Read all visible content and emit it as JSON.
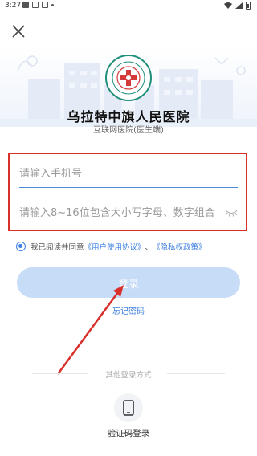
{
  "status_bar": {
    "time": "3:27"
  },
  "header": {
    "close_icon": "close-icon"
  },
  "brand": {
    "title": "乌拉特中旗人民医院",
    "subtitle": "互联网医院(医生端)",
    "logo_icon": "hospital-logo-icon"
  },
  "form": {
    "phone_placeholder": "请输入手机号",
    "phone_value": "",
    "password_placeholder": "请输入8~16位包含大小写字母、数字组合",
    "password_value": "",
    "eye_icon": "eye-closed-icon"
  },
  "agreement": {
    "checked": true,
    "prefix": "我已阅读并同意",
    "user_agreement": "《用户使用协议》",
    "separator": "、",
    "privacy_policy": "《隐私权政策》"
  },
  "login": {
    "button_label": "登录",
    "forgot_label": "忘记密码"
  },
  "other_login": {
    "label": "其他登录方式",
    "sms_label": "验证码登录",
    "sms_icon": "phone-icon"
  },
  "colors": {
    "accent": "#3d7fe0",
    "button_disabled": "#c6dcf7",
    "annotation_red": "#d9302c"
  }
}
